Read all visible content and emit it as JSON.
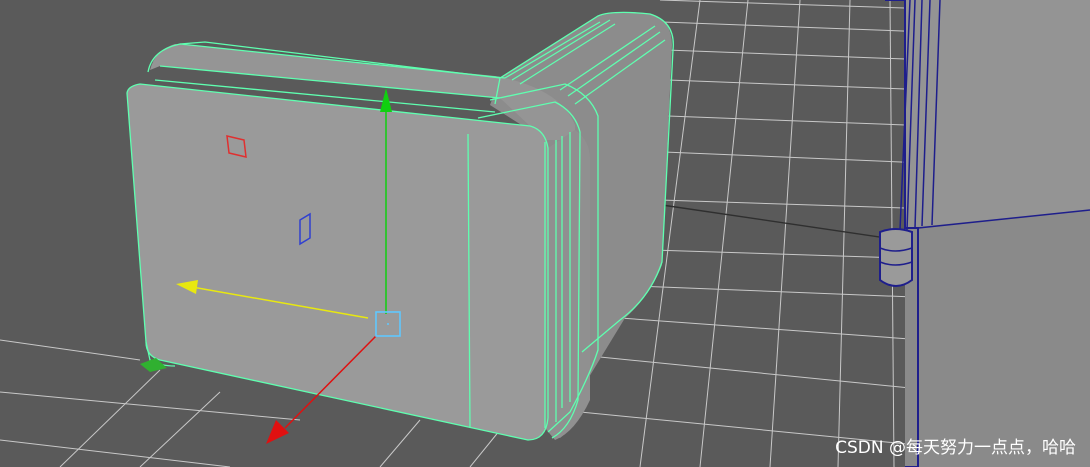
{
  "viewport": {
    "background": "#5a5a5a",
    "grid_color": "#c8c8c8",
    "grid_dark_line_color": "#2f2f2f"
  },
  "selected_object": {
    "wireframe_color": "#5fffb0",
    "face_color": "#9a9a9a",
    "side_color": "#8c8c8c"
  },
  "neighbor_object": {
    "wireframe_color": "#1e1e8c",
    "face_color": "#8a8a8a"
  },
  "manipulator": {
    "x_axis_color": "#e01010",
    "y_axis_color": "#10d010",
    "z_axis_color": "#e8e810",
    "pivot_color": "#60c8ff",
    "plane_handles": [
      "#e03030",
      "#3040d0"
    ]
  },
  "icons": [
    "move-tool-manipulator",
    "pivot-square"
  ],
  "watermark": {
    "text": "CSDN @每天努力一点点，哈哈",
    "color": "#ffffff"
  }
}
